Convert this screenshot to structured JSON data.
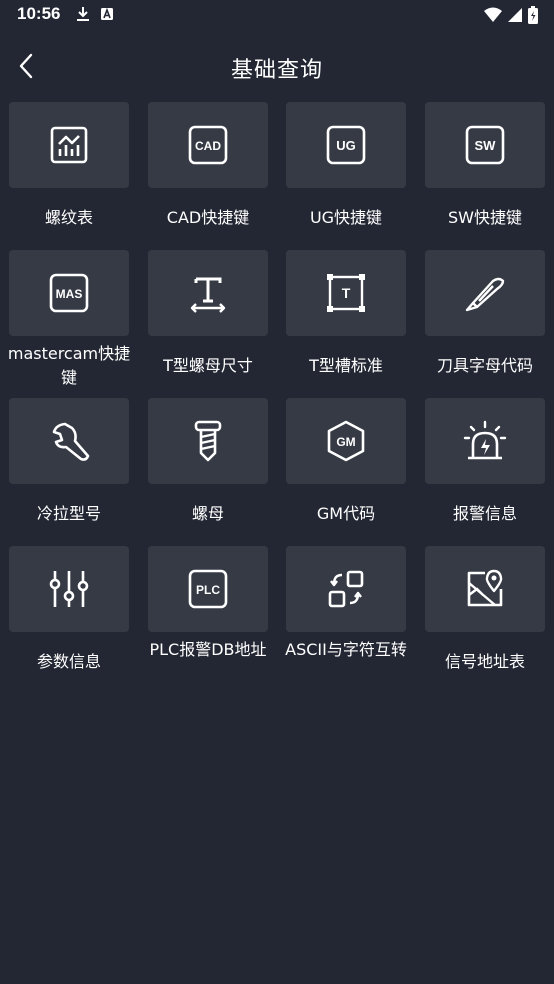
{
  "status": {
    "time": "10:56"
  },
  "header": {
    "title": "基础查询"
  },
  "tiles": [
    {
      "label": "螺纹表",
      "icon": "chart-icon"
    },
    {
      "label": "CAD快捷键",
      "icon": "cad-icon",
      "badge": "CAD"
    },
    {
      "label": "UG快捷键",
      "icon": "ug-icon",
      "badge": "UG"
    },
    {
      "label": "SW快捷键",
      "icon": "sw-icon",
      "badge": "SW"
    },
    {
      "label": "mastercam快捷键",
      "icon": "mas-icon",
      "badge": "MAS"
    },
    {
      "label": "T型螺母尺寸",
      "icon": "text-dimension-icon"
    },
    {
      "label": "T型槽标准",
      "icon": "t-slot-icon",
      "badge": "T"
    },
    {
      "label": "刀具字母代码",
      "icon": "knife-icon"
    },
    {
      "label": "冷拉型号",
      "icon": "wrench-icon"
    },
    {
      "label": "螺母",
      "icon": "screw-icon"
    },
    {
      "label": "GM代码",
      "icon": "gm-hexagon-icon",
      "badge": "GM"
    },
    {
      "label": "报警信息",
      "icon": "alarm-icon"
    },
    {
      "label": "参数信息",
      "icon": "sliders-icon"
    },
    {
      "label": "PLC报警DB地址",
      "icon": "plc-icon",
      "badge": "PLC"
    },
    {
      "label": "ASCII与字符互转",
      "icon": "convert-icon"
    },
    {
      "label": "信号地址表",
      "icon": "map-pin-icon"
    }
  ]
}
